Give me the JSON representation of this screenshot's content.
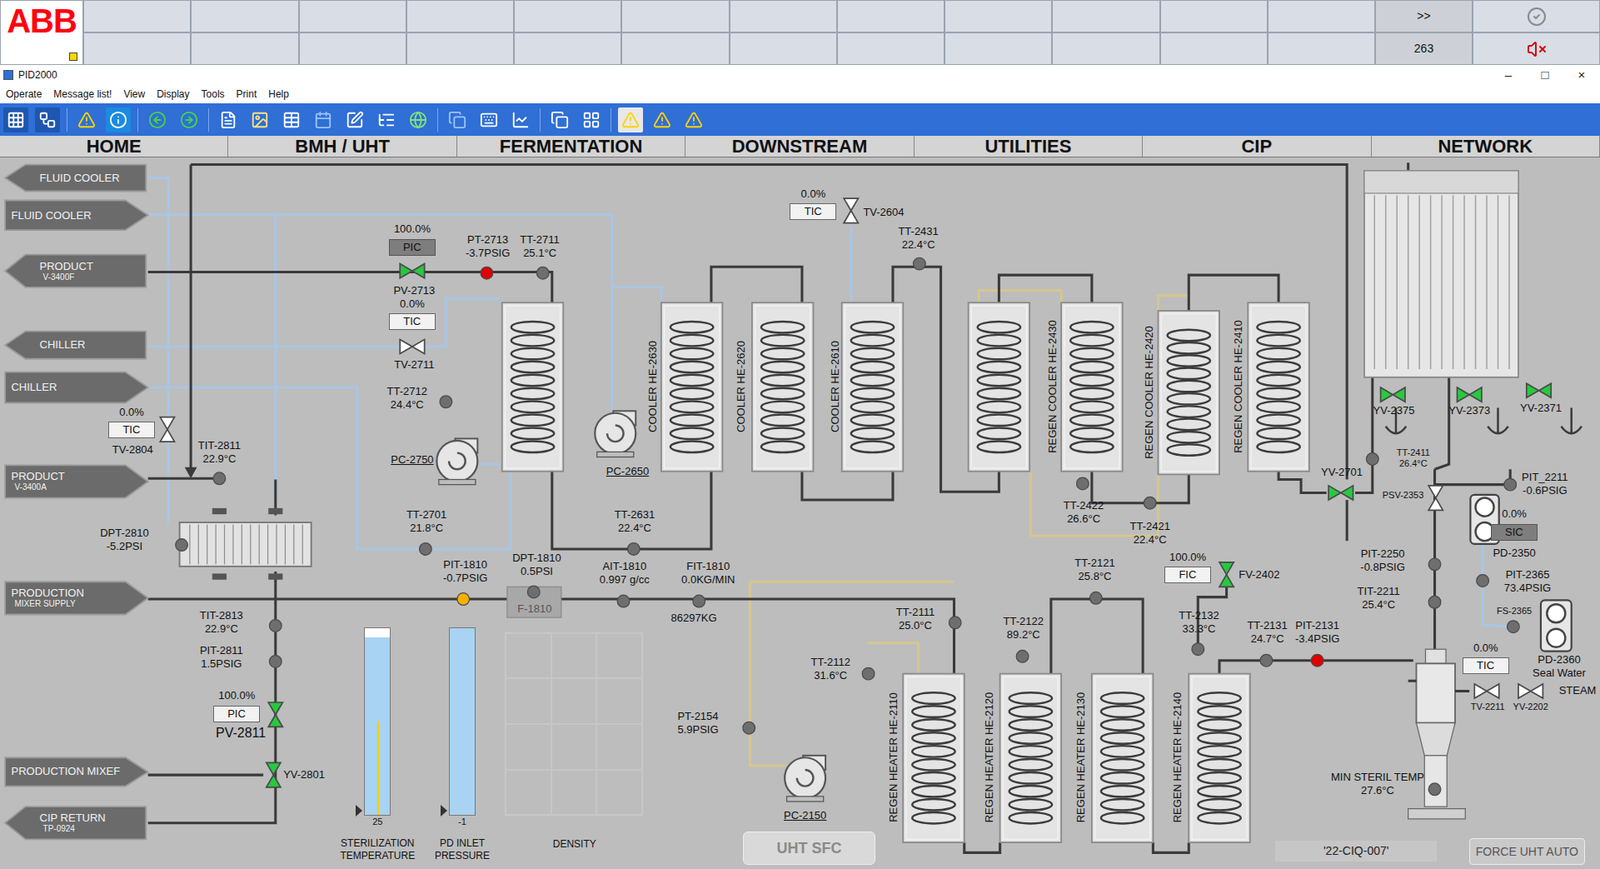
{
  "window": {
    "title": "PID2000",
    "controls": [
      "–",
      "□",
      "×"
    ]
  },
  "alarm_bar": {
    "logo": "ABB",
    "rows": [
      [
        "",
        "",
        "",
        "",
        "",
        "",
        "",
        "",
        "",
        "",
        "",
        ""
      ],
      [
        "",
        "",
        "",
        "",
        "",
        "",
        "",
        "",
        "",
        "",
        "",
        ""
      ]
    ],
    "more": ">>",
    "count": "263"
  },
  "menu": [
    "Operate",
    "Message list!",
    "View",
    "Display",
    "Tools",
    "Print",
    "Help"
  ],
  "nav_tabs": [
    {
      "label": "HOME",
      "selected": false
    },
    {
      "label": "BMH / UHT",
      "selected": false
    },
    {
      "label": "FERMENTATION",
      "selected": false
    },
    {
      "label": "DOWNSTREAM",
      "selected": false
    },
    {
      "label": "UTILITIES",
      "selected": false
    },
    {
      "label": "CIP",
      "selected": false
    },
    {
      "label": "NETWORK",
      "selected": false
    }
  ],
  "connectors": [
    {
      "label": "FLUID COOLER",
      "sub": "",
      "direction": "left"
    },
    {
      "label": "FLUID COOLER",
      "sub": "",
      "direction": "right"
    },
    {
      "label": "PRODUCT",
      "sub": "V-3400F",
      "direction": "left"
    },
    {
      "label": "CHILLER",
      "sub": "",
      "direction": "left"
    },
    {
      "label": "CHILLER",
      "sub": "",
      "direction": "right"
    },
    {
      "label": "PRODUCT",
      "sub": "V-3400A",
      "direction": "right"
    },
    {
      "label": "PRODUCTION",
      "sub": "MIXER SUPPLY",
      "direction": "right"
    },
    {
      "label": "PRODUCTION MIXEF",
      "sub": "",
      "direction": "right"
    },
    {
      "label": "CIP RETURN",
      "sub": "TP-0924",
      "direction": "left"
    }
  ],
  "controllers": [
    {
      "tag": "TIC",
      "output": "0.0%",
      "label": "TV-2604",
      "open": false,
      "highlighted": false
    },
    {
      "tag": "PIC",
      "output": "100.0%",
      "label": "PV-2713",
      "open": true,
      "highlighted": true
    },
    {
      "tag": "TIC",
      "output": "0.0%",
      "label": "TV-2711",
      "open": false,
      "highlighted": false
    },
    {
      "tag": "TIC",
      "output": "0.0%",
      "label": "TV-2804",
      "open": false,
      "highlighted": false
    },
    {
      "tag": "FIC",
      "output": "100.0%",
      "label": "FV-2402",
      "open": true,
      "highlighted": false
    },
    {
      "tag": "PIC",
      "output": "100.0%",
      "label": "PV-2811",
      "open": true,
      "highlighted": false
    },
    {
      "tag": "SIC",
      "output": "0.0%",
      "label": "PD-2350",
      "highlighted": true
    },
    {
      "tag": "TIC",
      "output": "0.0%",
      "label": "TV-2211",
      "open": false,
      "highlighted": false
    }
  ],
  "valves": [
    {
      "tag": "YV-2375",
      "open": true
    },
    {
      "tag": "YV-2373",
      "open": true
    },
    {
      "tag": "YV-2371",
      "open": true
    },
    {
      "tag": "YV-2701",
      "open": true
    },
    {
      "tag": "YV-2801",
      "open": true
    },
    {
      "tag": "YV-2202",
      "open": false
    },
    {
      "tag": "PSV-2353",
      "open": false
    }
  ],
  "readings": [
    {
      "tag": "PT-2713",
      "value": "-3.7PSIG",
      "color": "#e00000"
    },
    {
      "tag": "TT-2711",
      "value": "25.1°C",
      "color": "#6e6e6e"
    },
    {
      "tag": "TT-2712",
      "value": "24.4°C",
      "color": "#6e6e6e"
    },
    {
      "tag": "TIT-2811",
      "value": "22.9°C",
      "color": "#6e6e6e"
    },
    {
      "tag": "DPT-2810",
      "value": "-5.2PSI",
      "color": "#6e6e6e"
    },
    {
      "tag": "TT-2701",
      "value": "21.8°C",
      "color": "#6e6e6e"
    },
    {
      "tag": "TT-2631",
      "value": "22.4°C",
      "color": "#6e6e6e"
    },
    {
      "tag": "TT-2431",
      "value": "22.4°C",
      "color": "#6e6e6e"
    },
    {
      "tag": "TT-2422",
      "value": "26.6°C",
      "color": "#6e6e6e"
    },
    {
      "tag": "TT-2421",
      "value": "22.4°C",
      "color": "#6e6e6e"
    },
    {
      "tag": "TT-2411",
      "value": "26.4°C",
      "color": "#6e6e6e"
    },
    {
      "tag": "PIT_2211",
      "value": "-0.6PSIG",
      "color": "#6e6e6e"
    },
    {
      "tag": "PIT-2250",
      "value": "-0.8PSIG",
      "color": "#6e6e6e"
    },
    {
      "tag": "TIT-2211",
      "value": "25.4°C",
      "color": "#6e6e6e"
    },
    {
      "tag": "PIT-2365",
      "value": "73.4PSIG",
      "color": "#6e6e6e"
    },
    {
      "tag": "PIT-1810",
      "value": "-0.7PSIG",
      "color": "#f5b000"
    },
    {
      "tag": "DPT-1810",
      "value": "0.5PSI",
      "color": "#6e6e6e"
    },
    {
      "tag": "AIT-1810",
      "value": "0.997 g/cc",
      "color": "#6e6e6e"
    },
    {
      "tag": "FIT-1810",
      "value": "0.0KG/MIN",
      "color": "#6e6e6e"
    },
    {
      "tag": "TIT-2813",
      "value": "22.9°C",
      "color": "#6e6e6e"
    },
    {
      "tag": "PIT-2811",
      "value": "1.5PSIG",
      "color": "#6e6e6e"
    },
    {
      "tag": "TT-2121",
      "value": "25.8°C",
      "color": "#6e6e6e"
    },
    {
      "tag": "TT-2111",
      "value": "25.0°C",
      "color": "#6e6e6e"
    },
    {
      "tag": "TT-2122",
      "value": "89.2°C",
      "color": "#6e6e6e"
    },
    {
      "tag": "TT-2132",
      "value": "33.3°C",
      "color": "#6e6e6e"
    },
    {
      "tag": "TT-2131",
      "value": "24.7°C",
      "color": "#6e6e6e"
    },
    {
      "tag": "PIT-2131",
      "value": "-3.4PSIG",
      "color": "#e00000"
    },
    {
      "tag": "TT-2112",
      "value": "31.6°C",
      "color": "#6e6e6e"
    },
    {
      "tag": "PT-2154",
      "value": "5.9PSIG",
      "color": "#6e6e6e"
    },
    {
      "tag": "MIN STERIL TEMP",
      "value": "27.6°C",
      "color": "#6e6e6e"
    }
  ],
  "exchangers": [
    {
      "label": ""
    },
    {
      "label": "COOLER HE-2630"
    },
    {
      "label": "COOLER HE-2620"
    },
    {
      "label": "COOLER HE-2610"
    },
    {
      "label": ""
    },
    {
      "label": "REGEN COOLER HE-2430"
    },
    {
      "label": "REGEN COOLER HE-2420"
    },
    {
      "label": "REGEN COOLER HE-2410"
    },
    {
      "label": "REGEN HEATER HE-2110"
    },
    {
      "label": "REGEN HEATER HE-2120"
    },
    {
      "label": "REGEN HEATER HE-2130"
    },
    {
      "label": "REGEN HEATER HE-2140"
    }
  ],
  "pumps": [
    {
      "tag": "PC-2750"
    },
    {
      "tag": "PC-2650"
    },
    {
      "tag": "PC-2150"
    }
  ],
  "labels": [
    {
      "text": "FS-2365"
    },
    {
      "text": "PD-2360"
    },
    {
      "text": "Seal Water"
    },
    {
      "text": "STEAM"
    }
  ],
  "filter": {
    "tag": "F-1810"
  },
  "totalizer": {
    "value": "86297KG"
  },
  "gauges": [
    {
      "title": "STERILIZATION TEMPERATURE",
      "reading": "25",
      "level": 0.95,
      "marker": 0.5
    },
    {
      "title": "PD INLET PRESSURE",
      "reading": "-1",
      "level": 1
    }
  ],
  "density_chart": {
    "title": "DENSITY",
    "values": []
  },
  "buttons": [
    {
      "label": "UHT SFC"
    },
    {
      "label": "'22-CIQ-007'"
    },
    {
      "label": "FORCE UHT AUTO"
    }
  ]
}
